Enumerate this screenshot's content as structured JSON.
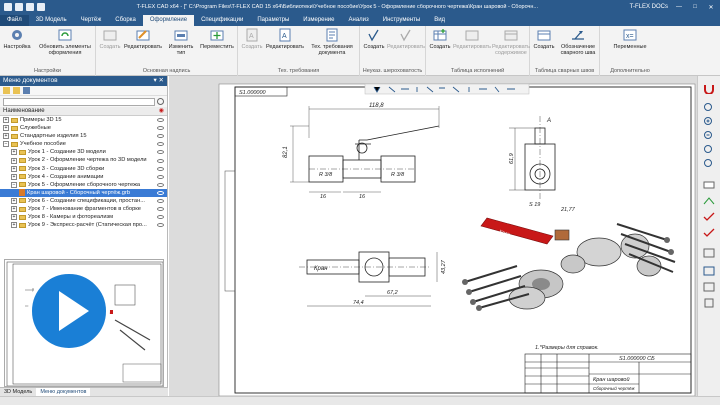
{
  "window": {
    "title": "T-FLEX CAD x64 - [\" C:\\Program Files\\T-FLEX CAD 15 x64\\Библиотеки\\Учебное пособие\\Урок 5 - Оформление сборочного чертежа\\Кран шаровой - Сборочн...",
    "product": "T-FLEX DOCs",
    "min": "—",
    "max": "□",
    "close": "✕"
  },
  "tabs": [
    "Файл",
    "3D Модель",
    "Чертёж",
    "Сборка",
    "Оформление",
    "Спецификации",
    "Параметры",
    "Измерение",
    "Анализ",
    "Инструменты",
    "Вид"
  ],
  "active_tab": "Оформление",
  "ribbon": {
    "groups": [
      {
        "label": "Настройки",
        "buttons": [
          {
            "label": "Настройка",
            "disabled": false
          },
          {
            "label": "Обновить элементы оформления",
            "disabled": false
          }
        ]
      },
      {
        "label": "Основная надпись",
        "buttons": [
          {
            "label": "Создать",
            "disabled": true
          },
          {
            "label": "Редактировать",
            "disabled": false
          },
          {
            "label": "Изменить тип",
            "disabled": false
          },
          {
            "label": "Переместить",
            "disabled": false
          }
        ]
      },
      {
        "label": "Тех. требования",
        "buttons": [
          {
            "label": "Создать",
            "disabled": true
          },
          {
            "label": "Редактировать",
            "disabled": false
          },
          {
            "label": "Тех. требования документа",
            "disabled": false
          }
        ]
      },
      {
        "label": "Неуказ. шероховатость",
        "buttons": [
          {
            "label": "Создать",
            "disabled": false
          },
          {
            "label": "Редактировать",
            "disabled": true
          }
        ]
      },
      {
        "label": "Таблица исполнений",
        "buttons": [
          {
            "label": "Создать",
            "disabled": false
          },
          {
            "label": "Редактировать",
            "disabled": true
          },
          {
            "label": "Редактировать содержимое",
            "disabled": true
          }
        ]
      },
      {
        "label": "Таблица сварных швов",
        "buttons": [
          {
            "label": "Создать",
            "disabled": false
          },
          {
            "label": "Обозначение сварного шва",
            "disabled": false
          }
        ]
      },
      {
        "label": "Дополнительно",
        "buttons": [
          {
            "label": "Переменные",
            "disabled": false
          }
        ]
      }
    ]
  },
  "left_panel": {
    "title": "Меню документов",
    "pin": "▾ ✕",
    "column": "Наименование",
    "items": [
      {
        "label": "Примеры 3D 15",
        "level": 0,
        "type": "folder",
        "expander": "+",
        "selected": false
      },
      {
        "label": "Служебные",
        "level": 0,
        "type": "folder",
        "expander": "+",
        "selected": false
      },
      {
        "label": "Стандартные изделия 15",
        "level": 0,
        "type": "folder",
        "expander": "+",
        "selected": false
      },
      {
        "label": "Учебное пособие",
        "level": 0,
        "type": "folder",
        "expander": "−",
        "selected": false
      },
      {
        "label": "Урок 1 - Создание 3D модели",
        "level": 1,
        "type": "folder",
        "expander": "+",
        "selected": false
      },
      {
        "label": "Урок 2 - Оформление чертежа по 3D модели",
        "level": 1,
        "type": "folder",
        "expander": "+",
        "selected": false
      },
      {
        "label": "Урок 3 - Создание 3D сборки",
        "level": 1,
        "type": "folder",
        "expander": "+",
        "selected": false
      },
      {
        "label": "Урок 4 - Создание анимации",
        "level": 1,
        "type": "folder",
        "expander": "+",
        "selected": false
      },
      {
        "label": "Урок 5 - Оформление сборочного чертежа",
        "level": 1,
        "type": "folder",
        "expander": "−",
        "selected": false
      },
      {
        "label": "Кран шаровой - Сборочный чертёж.grb",
        "level": 2,
        "type": "doc",
        "expander": "",
        "selected": true
      },
      {
        "label": "Урок 6 - Создание спецификации, простан...",
        "level": 1,
        "type": "folder",
        "expander": "+",
        "selected": false
      },
      {
        "label": "Урок 7 - Именование фрагментов в сборке",
        "level": 1,
        "type": "folder",
        "expander": "+",
        "selected": false
      },
      {
        "label": "Урок 8 - Камеры и фотореализм",
        "level": 1,
        "type": "folder",
        "expander": "+",
        "selected": false
      },
      {
        "label": "Урок 9 - Экспресс-расчёт (Статическая про...",
        "level": 1,
        "type": "folder",
        "expander": "+",
        "selected": false
      }
    ],
    "bottom_tabs": [
      "3D Модель",
      "Меню документов"
    ],
    "active_bottom_tab": "Меню документов"
  },
  "drawing": {
    "corner_code": "S1.000000",
    "dims": {
      "top": "118,8",
      "height": "82,1",
      "thread1": "R 3/8",
      "thread2": "R 3/8",
      "len1": "16",
      "len2": "16",
      "right_h": "61,9",
      "right_s": "S 19",
      "right_len": "21,77",
      "bottom_len": "67,2",
      "bottom_total": "74,4",
      "bottom_h": "43,27"
    },
    "section_label": "A",
    "handle_text": "Кран",
    "note": "1.*Размеры для справок.",
    "stamp_code": "S1.000000 СБ",
    "stamp_title": "Кран шаровой",
    "stamp_sub": "Сборочный чертёж"
  },
  "colors": {
    "titlebar": "#2b5a8c",
    "accent": "#1a7fd6",
    "selection": "#3a7bd5",
    "handle": "#c81818"
  },
  "icons": [
    "settings-icon",
    "refresh-icon",
    "stamp-icon",
    "edit-icon",
    "requirements-icon",
    "roughness-icon",
    "table-icon",
    "weld-icon",
    "variables-icon",
    "play-icon"
  ]
}
